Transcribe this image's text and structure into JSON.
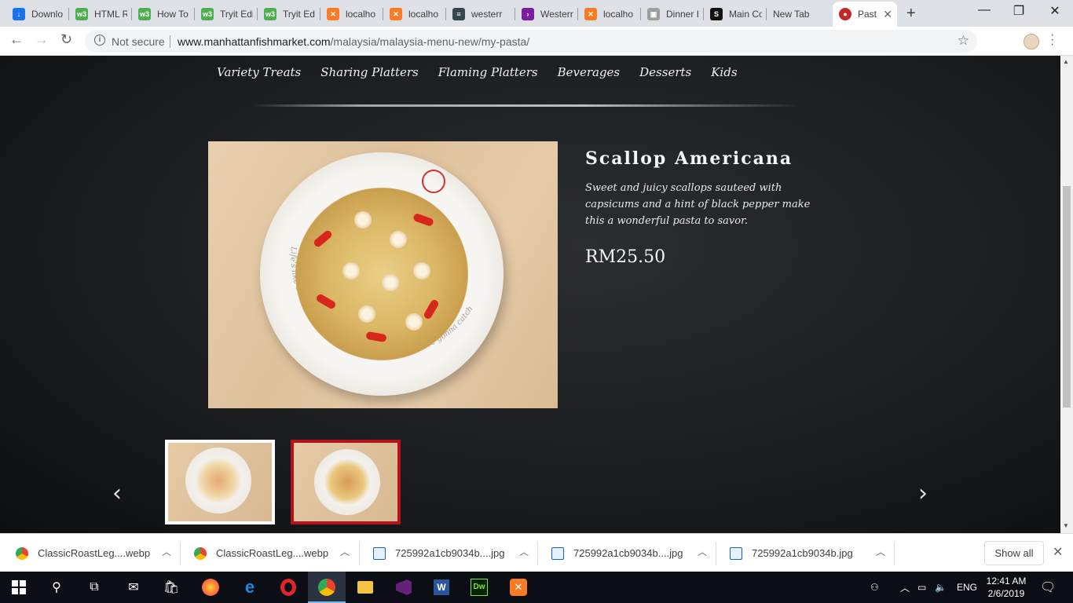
{
  "browser": {
    "tabs": [
      {
        "title": "Downlo",
        "icon": "download-icon",
        "color": "#1a73e8"
      },
      {
        "title": "HTML R",
        "icon": "w3schools-icon",
        "color": "#4caf50"
      },
      {
        "title": "How To",
        "icon": "w3schools-icon",
        "color": "#4caf50"
      },
      {
        "title": "Tryit Edi",
        "icon": "w3schools-icon",
        "color": "#4caf50"
      },
      {
        "title": "Tryit Ed",
        "icon": "w3schools-icon",
        "color": "#4caf50"
      },
      {
        "title": "localho",
        "icon": "xampp-icon",
        "color": "#fb7a24"
      },
      {
        "title": "localho",
        "icon": "xampp-icon",
        "color": "#fb7a24"
      },
      {
        "title": "westerr",
        "icon": "page-icon",
        "color": "#37474f"
      },
      {
        "title": "Westerr",
        "icon": "arrow-icon",
        "color": "#7b1fa2"
      },
      {
        "title": "localho",
        "icon": "xampp-icon",
        "color": "#fb7a24"
      },
      {
        "title": "Dinner I",
        "icon": "image-icon",
        "color": "#9e9e9e"
      },
      {
        "title": "Main Co",
        "icon": "s-icon",
        "color": "#111111"
      },
      {
        "title": "New Tab",
        "icon": "",
        "color": ""
      },
      {
        "title": "Past",
        "icon": "mfm-icon",
        "color": "#c62828"
      }
    ],
    "url": {
      "security": "Not secure",
      "host": "www.manhattanfishmarket.com",
      "path": "/malaysia/malaysia-menu-new/my-pasta/"
    }
  },
  "page": {
    "categories": [
      "Variety Treats",
      "Sharing Platters",
      "Flaming Platters",
      "Beverages",
      "Desserts",
      "Kids"
    ],
    "dish": {
      "title": "Scallop Americana",
      "description": "Sweet and juicy scallops sauteed with capsicums and a hint of black pepper make this a wonderful pasta to savor.",
      "price": "RM25.50",
      "plate_text": "Life's like a sea of fish. You'll never know what you're gonna catch."
    },
    "carousel": {
      "prev": "‹",
      "next": "›"
    }
  },
  "downloads": {
    "items": [
      {
        "name": "ClassicRoastLeg....webp",
        "icon": "chrome-icon"
      },
      {
        "name": "ClassicRoastLeg....webp",
        "icon": "chrome-icon"
      },
      {
        "name": "725992a1cb9034b....jpg",
        "icon": "image-file-icon"
      },
      {
        "name": "725992a1cb9034b....jpg",
        "icon": "image-file-icon"
      },
      {
        "name": "725992a1cb9034b.jpg",
        "icon": "image-file-icon"
      }
    ],
    "show_all": "Show all"
  },
  "taskbar": {
    "language": "ENG",
    "time": "12:41 AM",
    "date": "2/6/2019"
  }
}
